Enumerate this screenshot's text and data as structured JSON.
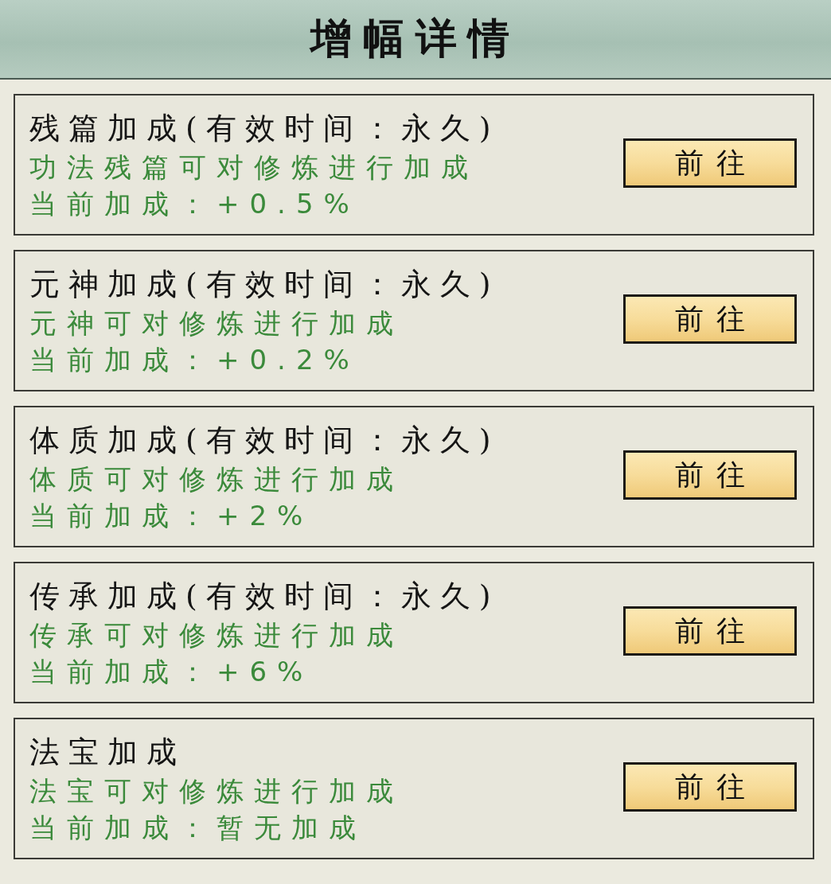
{
  "header": {
    "title": "增幅详情"
  },
  "bonuses": [
    {
      "title": "残篇加成(有效时间：永久)",
      "description": "功法残篇可对修炼进行加成",
      "current": "当前加成：+0.5%",
      "button": "前往"
    },
    {
      "title": "元神加成(有效时间：永久)",
      "description": "元神可对修炼进行加成",
      "current": "当前加成：+0.2%",
      "button": "前往"
    },
    {
      "title": "体质加成(有效时间：永久)",
      "description": "体质可对修炼进行加成",
      "current": "当前加成：+2%",
      "button": "前往"
    },
    {
      "title": "传承加成(有效时间：永久)",
      "description": "传承可对修炼进行加成",
      "current": "当前加成：+6%",
      "button": "前往"
    },
    {
      "title": "法宝加成",
      "description": "法宝可对修炼进行加成",
      "current": "当前加成：暂无加成",
      "button": "前往"
    }
  ]
}
